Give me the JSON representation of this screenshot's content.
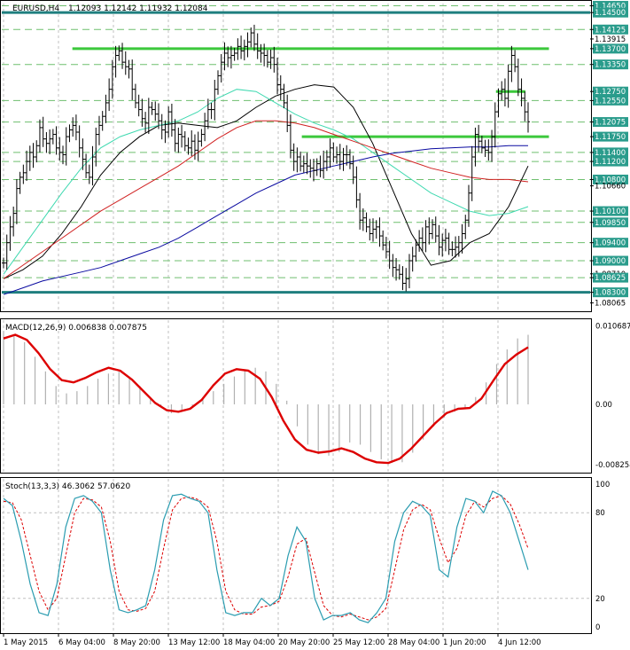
{
  "header": {
    "symbol": "EURUSD,H4",
    "ohlc": "1.12093 1.12142 1.11932 1.12084"
  },
  "colors": {
    "background": "#ffffff",
    "frame": "#000000",
    "grid": "#c0c0c0",
    "level_label_bg": "#2a9c8c",
    "resistance_support": "#3cc83c",
    "key_level": "#1f7f7f",
    "ma_black": "#000000",
    "ma_aqua": "#3fd9b0",
    "ma_red": "#d02020",
    "ma_blue": "#0a0aa0",
    "macd_signal": "#dd0000",
    "macd_hist": "#b0b0b0",
    "stoch_main": "#2a9cb0",
    "stoch_signal": "#dd0000"
  },
  "chart_data": [
    {
      "type": "line",
      "panel": "price",
      "title": "EURUSD,H4",
      "ylim": [
        1.079,
        1.147
      ],
      "price_axis_labels": [
        "1.14650",
        "1.14500",
        "1.14125",
        "1.13915",
        "1.13700",
        "1.13350",
        "1.12750",
        "1.12550",
        "1.12075",
        "1.11750",
        "1.11400",
        "1.11200",
        "1.10800",
        "1.10660",
        "1.10100",
        "1.09850",
        "1.09400",
        "1.09000",
        "1.08710",
        "1.08625",
        "1.08300",
        "1.08065"
      ],
      "highlighted_levels": [
        "1.14650",
        "1.14500",
        "1.14125",
        "1.13700",
        "1.13350",
        "1.12750",
        "1.12550",
        "1.12075",
        "1.11750",
        "1.11400",
        "1.11200",
        "1.10800",
        "1.10100",
        "1.09850",
        "1.09400",
        "1.09000",
        "1.08625",
        "1.08300"
      ],
      "horizontal_lines": [
        {
          "kind": "key",
          "value": 1.145,
          "x_from": 0.0,
          "x_to": 1.0
        },
        {
          "kind": "key",
          "value": 1.083,
          "x_from": 0.0,
          "x_to": 1.0
        },
        {
          "kind": "green",
          "value": 1.137,
          "x_from": 0.12,
          "x_to": 0.93
        },
        {
          "kind": "green",
          "value": 1.1175,
          "x_from": 0.51,
          "x_to": 0.93
        },
        {
          "kind": "green",
          "value": 1.1275,
          "x_from": 0.84,
          "x_to": 0.89
        }
      ],
      "dashed_levels": [
        1.1465,
        1.14125,
        1.1335,
        1.1255,
        1.12075,
        1.114,
        1.112,
        1.108,
        1.101,
        1.0985,
        1.094,
        1.09,
        1.08625
      ],
      "close_series": [
        1.0895,
        1.094,
        1.0975,
        1.1005,
        1.106,
        1.1085,
        1.1095,
        1.112,
        1.114,
        1.113,
        1.1155,
        1.1195,
        1.117,
        1.116,
        1.117,
        1.118,
        1.115,
        1.114,
        1.1135,
        1.1175,
        1.119,
        1.12,
        1.1185,
        1.115,
        1.1125,
        1.1095,
        1.1085,
        1.113,
        1.118,
        1.12,
        1.122,
        1.125,
        1.128,
        1.133,
        1.1355,
        1.1365,
        1.134,
        1.133,
        1.1325,
        1.128,
        1.125,
        1.1235,
        1.1215,
        1.1205,
        1.124,
        1.1235,
        1.1225,
        1.121,
        1.119,
        1.1185,
        1.123,
        1.119,
        1.116,
        1.118,
        1.1175,
        1.1155,
        1.115,
        1.1165,
        1.1145,
        1.1165,
        1.118,
        1.121,
        1.1235,
        1.1235,
        1.128,
        1.131,
        1.134,
        1.136,
        1.135,
        1.1355,
        1.136,
        1.1375,
        1.1365,
        1.1375,
        1.1385,
        1.1405,
        1.138,
        1.1365,
        1.136,
        1.1355,
        1.134,
        1.135,
        1.1335,
        1.129,
        1.128,
        1.125,
        1.12,
        1.1145,
        1.112,
        1.113,
        1.111,
        1.1115,
        1.111,
        1.1105,
        1.11,
        1.1115,
        1.11,
        1.112,
        1.113,
        1.115,
        1.113,
        1.1135,
        1.112,
        1.1135,
        1.1135,
        1.1115,
        1.1085,
        1.1035,
        1.099,
        1.0995,
        1.0975,
        1.096,
        1.097,
        1.0975,
        1.0955,
        1.0935,
        1.092,
        1.09,
        1.0885,
        1.088,
        1.087,
        1.085,
        1.086,
        1.09,
        1.091,
        1.0935,
        1.095,
        1.094,
        1.0975,
        1.096,
        1.098,
        1.0955,
        1.093,
        1.0945,
        1.095,
        1.0925,
        1.0925,
        1.093,
        1.094,
        1.096,
        1.099,
        1.105,
        1.113,
        1.118,
        1.1165,
        1.115,
        1.1145,
        1.114,
        1.1175,
        1.123,
        1.127,
        1.128,
        1.126,
        1.132,
        1.1355,
        1.133,
        1.128,
        1.126,
        1.123,
        1.1208
      ],
      "series": [
        {
          "name": "MA black",
          "values": [
            1.086,
            1.088,
            1.091,
            1.096,
            1.102,
            1.109,
            1.114,
            1.1175,
            1.12,
            1.1205,
            1.12,
            1.1195,
            1.121,
            1.124,
            1.1265,
            1.128,
            1.129,
            1.1285,
            1.124,
            1.116,
            1.106,
            1.096,
            1.089,
            1.09,
            1.094,
            1.096,
            1.102,
            1.111
          ]
        },
        {
          "name": "MA aqua",
          "values": [
            1.087,
            1.093,
            1.099,
            1.105,
            1.1105,
            1.115,
            1.1175,
            1.119,
            1.12,
            1.121,
            1.123,
            1.126,
            1.128,
            1.1275,
            1.125,
            1.1225,
            1.1205,
            1.119,
            1.117,
            1.114,
            1.111,
            1.108,
            1.105,
            1.103,
            1.101,
            1.1,
            1.1005,
            1.102
          ]
        },
        {
          "name": "MA red",
          "values": [
            1.086,
            1.089,
            1.092,
            1.095,
            1.098,
            1.101,
            1.1035,
            1.106,
            1.1085,
            1.111,
            1.114,
            1.117,
            1.1195,
            1.121,
            1.121,
            1.1205,
            1.1195,
            1.118,
            1.1165,
            1.115,
            1.1135,
            1.112,
            1.1105,
            1.1095,
            1.1085,
            1.108,
            1.108,
            1.1075
          ]
        },
        {
          "name": "MA blue",
          "values": [
            1.0825,
            1.084,
            1.0855,
            1.0865,
            1.0875,
            1.0885,
            1.09,
            1.0915,
            1.093,
            1.095,
            1.0975,
            1.1,
            1.1025,
            1.105,
            1.107,
            1.109,
            1.11,
            1.111,
            1.112,
            1.113,
            1.1138,
            1.1143,
            1.1148,
            1.115,
            1.1152,
            1.1152,
            1.1155,
            1.1155
          ]
        }
      ],
      "x_labels": [
        "1 May 2015",
        "6 May 04:00",
        "8 May 20:00",
        "13 May 12:00",
        "18 May 04:00",
        "20 May 20:00",
        "25 May 12:00",
        "28 May 04:00",
        "1 Jun 20:00",
        "4 Jun 12:00"
      ]
    },
    {
      "type": "bar",
      "panel": "macd",
      "title": "MACD(12,26,9) 0.006838 0.007875",
      "ylim": [
        -0.0092,
        0.0115
      ],
      "axis_labels": [
        "0.010687",
        "0.00",
        "-0.008254"
      ],
      "histogram": [
        0.01,
        0.0095,
        0.0085,
        0.0065,
        0.0045,
        0.0025,
        0.0015,
        0.0018,
        0.0025,
        0.0035,
        0.0042,
        0.0045,
        0.0038,
        0.0025,
        0.001,
        -0.0003,
        -0.0012,
        -0.001,
        -0.0002,
        0.0008,
        0.0018,
        0.0028,
        0.0038,
        0.0046,
        0.005,
        0.0045,
        0.0028,
        0.0005,
        -0.003,
        -0.0055,
        -0.0068,
        -0.007,
        -0.0065,
        -0.0052,
        -0.0055,
        -0.0065,
        -0.0075,
        -0.008,
        -0.0079,
        -0.0066,
        -0.0048,
        -0.003,
        -0.0018,
        -0.001,
        -0.0005,
        0.001,
        0.003,
        0.0055,
        0.0075,
        0.009,
        0.0095
      ],
      "signal": [
        0.009,
        0.0095,
        0.0088,
        0.007,
        0.0048,
        0.0033,
        0.003,
        0.0036,
        0.0044,
        0.005,
        0.0046,
        0.0034,
        0.0018,
        0.0002,
        -0.0008,
        -0.001,
        -0.0006,
        0.0006,
        0.0026,
        0.0042,
        0.0048,
        0.0046,
        0.0035,
        0.001,
        -0.0022,
        -0.0048,
        -0.0062,
        -0.0066,
        -0.0064,
        -0.006,
        -0.0065,
        -0.0074,
        -0.0079,
        -0.008,
        -0.0074,
        -0.006,
        -0.0043,
        -0.0026,
        -0.0012,
        -0.0006,
        -0.0005,
        0.0008,
        0.0032,
        0.0055,
        0.0068,
        0.0078
      ]
    },
    {
      "type": "line",
      "panel": "stochastic",
      "title": "Stoch(13,3,3) 46.3062 57.0620",
      "ylim": [
        0,
        100
      ],
      "axis_labels": [
        "100",
        "80",
        "20",
        "0"
      ],
      "series": [
        {
          "name": "main",
          "values": [
            90,
            85,
            60,
            30,
            10,
            8,
            30,
            70,
            90,
            92,
            88,
            80,
            40,
            12,
            10,
            12,
            15,
            40,
            75,
            92,
            93,
            90,
            88,
            80,
            40,
            10,
            8,
            10,
            10,
            20,
            15,
            20,
            50,
            70,
            60,
            20,
            5,
            8,
            8,
            10,
            5,
            3,
            10,
            20,
            60,
            80,
            88,
            85,
            78,
            40,
            35,
            70,
            90,
            88,
            80,
            95,
            92,
            80,
            60,
            40
          ]
        },
        {
          "name": "signal",
          "values": [
            88,
            87,
            75,
            50,
            25,
            12,
            20,
            50,
            80,
            90,
            89,
            84,
            60,
            25,
            12,
            11,
            13,
            25,
            55,
            82,
            90,
            91,
            89,
            84,
            60,
            25,
            12,
            9,
            9,
            14,
            15,
            18,
            35,
            58,
            62,
            38,
            15,
            8,
            7,
            9,
            7,
            5,
            7,
            13,
            40,
            68,
            82,
            86,
            82,
            62,
            45,
            55,
            78,
            88,
            84,
            90,
            92,
            86,
            72,
            55
          ]
        }
      ]
    }
  ]
}
